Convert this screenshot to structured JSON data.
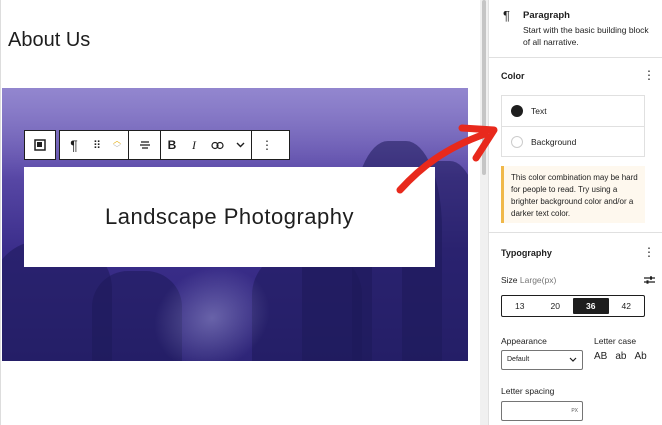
{
  "editor": {
    "page_title": "About Us",
    "heading_text": "Landscape Photography",
    "toolbar": {
      "block_type_icon": "pilcrow-icon",
      "drag_icon": "drag-handle-icon",
      "move_icon": "move-up-down-icon",
      "align_icon": "align-center-icon",
      "bold_label": "B",
      "italic_label": "I",
      "link_icon": "link-icon",
      "more_icon": "chevron-down-icon",
      "options_icon": "more-vertical-icon"
    }
  },
  "sidebar": {
    "block": {
      "icon": "pilcrow-icon",
      "name": "Paragraph",
      "description": "Start with the basic building block of all narrative."
    },
    "color": {
      "title": "Color",
      "items": [
        {
          "label": "Text",
          "swatch": "#1e1e1e"
        },
        {
          "label": "Background",
          "swatch": "#ffffff"
        }
      ],
      "notice": "This color combination may be hard for people to read. Try using a brighter background color and/or a darker text color."
    },
    "typography": {
      "title": "Typography",
      "size_label": "Size",
      "size_sub": "Large(px)",
      "sizes": [
        "13",
        "20",
        "36",
        "42"
      ],
      "selected_size": "36",
      "appearance_label": "Appearance",
      "appearance_value": "Default",
      "letter_case_label": "Letter case",
      "letter_case_options": [
        "AB",
        "ab",
        "Ab"
      ],
      "letter_spacing_label": "Letter spacing",
      "letter_spacing_unit": "PX"
    }
  },
  "colors": {
    "warning_border": "#f0b849",
    "annotation_arrow": "#e8291c"
  }
}
